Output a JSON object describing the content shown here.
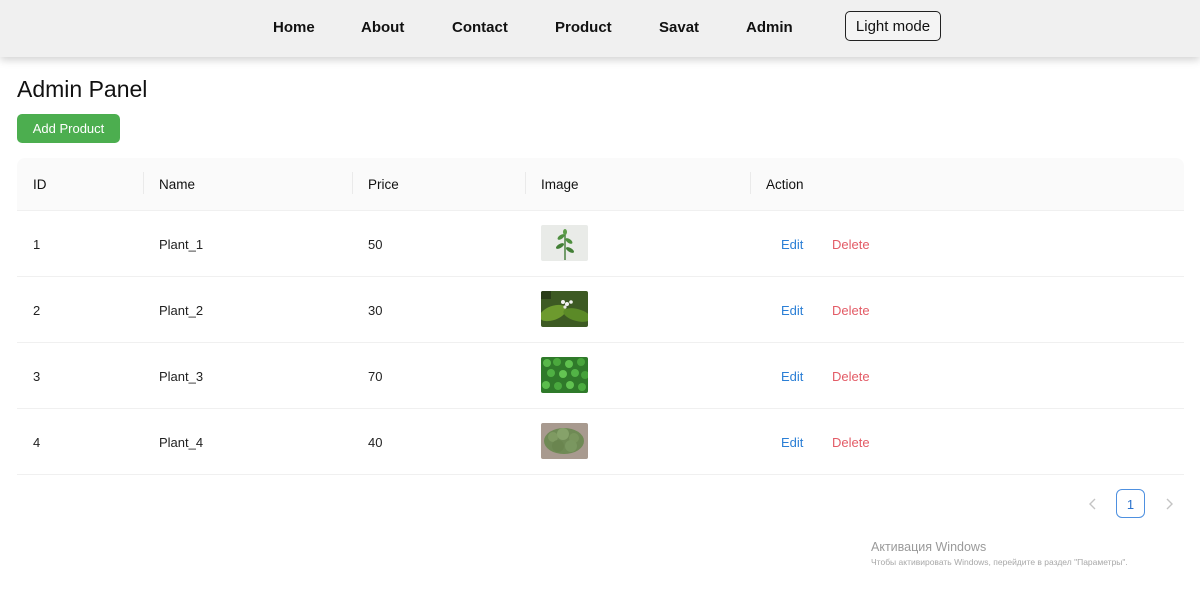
{
  "nav": {
    "links": [
      "Home",
      "About",
      "Contact",
      "Product",
      "Savat",
      "Admin"
    ],
    "theme_button": "Light mode"
  },
  "page": {
    "title": "Admin Panel",
    "add_button": "Add Product"
  },
  "table": {
    "headers": [
      "ID",
      "Name",
      "Price",
      "Image",
      "Action"
    ],
    "rows": [
      {
        "id": "1",
        "name": "Plant_1",
        "price": "50",
        "image": "plant-sprig-thumbnail",
        "edit": "Edit",
        "delete": "Delete"
      },
      {
        "id": "2",
        "name": "Plant_2",
        "price": "30",
        "image": "lily-of-the-valley-thumbnail",
        "edit": "Edit",
        "delete": "Delete"
      },
      {
        "id": "3",
        "name": "Plant_3",
        "price": "70",
        "image": "fern-leaves-thumbnail",
        "edit": "Edit",
        "delete": "Delete"
      },
      {
        "id": "4",
        "name": "Plant_4",
        "price": "40",
        "image": "moss-thumbnail",
        "edit": "Edit",
        "delete": "Delete"
      }
    ]
  },
  "pagination": {
    "prev_icon": "chevron-left-icon",
    "current_page": "1",
    "next_icon": "chevron-right-icon"
  },
  "watermark": {
    "title": "Активация Windows",
    "subtitle": "Чтобы активировать Windows, перейдите в раздел \"Параметры\"."
  },
  "colors": {
    "add_button": "#4cae4f",
    "edit_link": "#2b7fd6",
    "delete_link": "#e35b66",
    "active_page": "#4e90e0"
  }
}
